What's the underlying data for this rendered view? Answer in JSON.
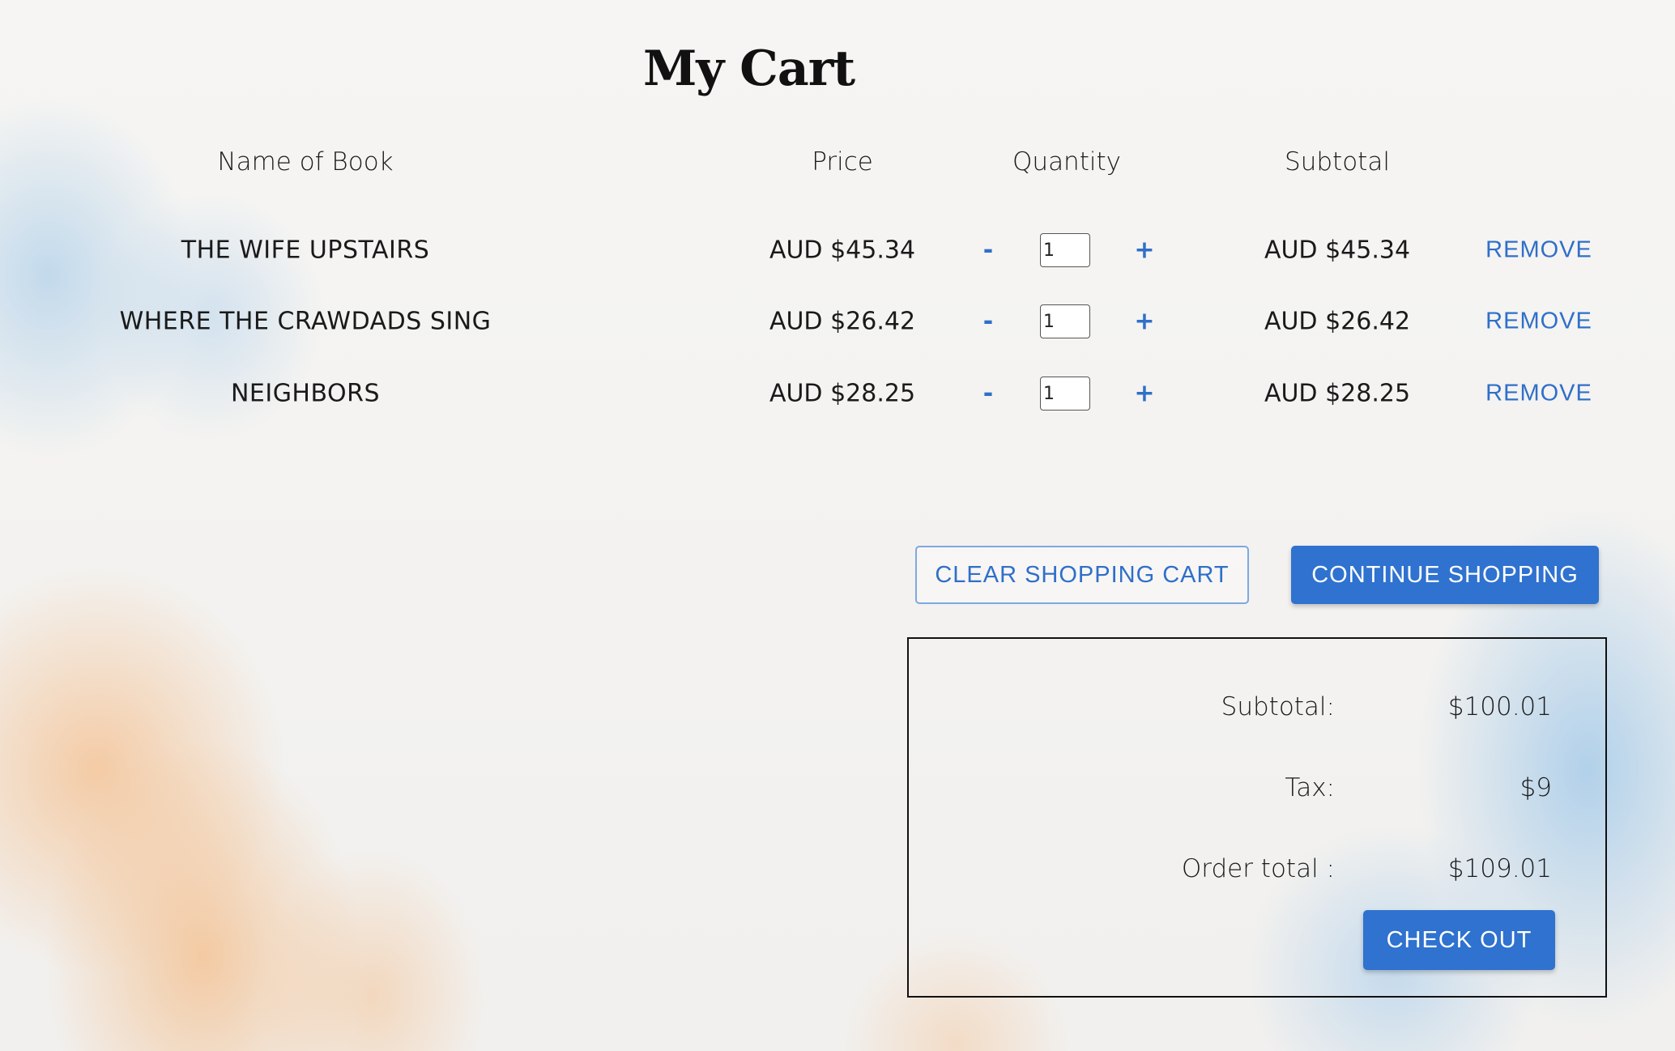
{
  "page": {
    "title": "My Cart"
  },
  "table": {
    "headers": {
      "name": "Name of Book",
      "price": "Price",
      "quantity": "Quantity",
      "subtotal": "Subtotal"
    },
    "rows": [
      {
        "name": "THE WIFE UPSTAIRS",
        "price": "AUD $45.34",
        "quantity": "1",
        "subtotal": "AUD $45.34"
      },
      {
        "name": "WHERE THE CRAWDADS SING",
        "price": "AUD $26.42",
        "quantity": "1",
        "subtotal": "AUD $26.42"
      },
      {
        "name": "NEIGHBORS",
        "price": "AUD $28.25",
        "quantity": "1",
        "subtotal": "AUD $28.25"
      }
    ],
    "minus_label": "-",
    "plus_label": "+",
    "remove_label": "REMOVE"
  },
  "actions": {
    "clear_label": "CLEAR SHOPPING CART",
    "continue_label": "CONTINUE SHOPPING"
  },
  "summary": {
    "subtotal_label": "Subtotal:",
    "subtotal_value": "$100.01",
    "tax_label": "Tax:",
    "tax_value": "$9",
    "total_label": "Order total :",
    "total_value": "$109.01",
    "checkout_label": "CHECK OUT"
  },
  "colors": {
    "accent": "#2f72cf",
    "text": "#1a1a1a"
  }
}
